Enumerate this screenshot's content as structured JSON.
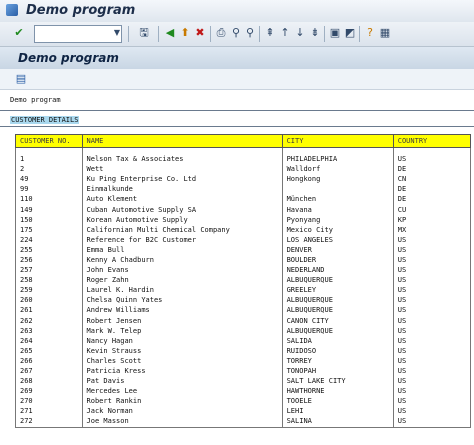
{
  "window": {
    "title": "Demo program"
  },
  "page": {
    "title": "Demo program",
    "heading": "Demo program",
    "section": "CUSTOMER DETAILS"
  },
  "table": {
    "columns": [
      "CUSTOMER NO.",
      "NAME",
      "CITY",
      "COUNTRY"
    ],
    "rows": [
      [
        "1",
        "Nelson Tax & Associates",
        "PHILADELPHIA",
        "US"
      ],
      [
        "2",
        "Wett",
        "Walldorf",
        "DE"
      ],
      [
        "49",
        "Ku Ping Enterprise Co. Ltd",
        "Hongkong",
        "CN"
      ],
      [
        "99",
        "Einmalkunde",
        "",
        "DE"
      ],
      [
        "110",
        "Auto Klement",
        "München",
        "DE"
      ],
      [
        "149",
        "Cuban Automotive Supply SA",
        "Havana",
        "CU"
      ],
      [
        "150",
        "Korean Automotive Supply",
        "Pyonyang",
        "KP"
      ],
      [
        "175",
        "Californian Multi Chemical Company",
        "Mexico City",
        "MX"
      ],
      [
        "224",
        "Reference for B2C Customer",
        "LOS ANGELES",
        "US"
      ],
      [
        "255",
        "Emma Bull",
        "DENVER",
        "US"
      ],
      [
        "256",
        "Kenny A Chadburn",
        "BOULDER",
        "US"
      ],
      [
        "257",
        "John Evans",
        "NEDERLAND",
        "US"
      ],
      [
        "258",
        "Roger Zahn",
        "ALBUQUERQUE",
        "US"
      ],
      [
        "259",
        "Laurel K. Hardin",
        "GREELEY",
        "US"
      ],
      [
        "260",
        "Chelsa Quinn Yates",
        "ALBUQUERQUE",
        "US"
      ],
      [
        "261",
        "Andrew Williams",
        "ALBUQUERQUE",
        "US"
      ],
      [
        "262",
        "Robert Jensen",
        "CANON CITY",
        "US"
      ],
      [
        "263",
        "Mark W. Telep",
        "ALBUQUERQUE",
        "US"
      ],
      [
        "264",
        "Nancy Hagan",
        "SALIDA",
        "US"
      ],
      [
        "265",
        "Kevin Strauss",
        "RUIDOSO",
        "US"
      ],
      [
        "266",
        "Charles Scott",
        "TORREY",
        "US"
      ],
      [
        "267",
        "Patricia Kress",
        "TONOPAH",
        "US"
      ],
      [
        "268",
        "Pat Davis",
        "SALT LAKE CITY",
        "US"
      ],
      [
        "269",
        "Mercedes Lee",
        "HAWTHORNE",
        "US"
      ],
      [
        "270",
        "Robert Rankin",
        "TOOELE",
        "US"
      ],
      [
        "271",
        "Jack Norman",
        "LEHI",
        "US"
      ],
      [
        "272",
        "Joe Masson",
        "SALINA",
        "US"
      ]
    ]
  },
  "colors": {
    "header_bg": "#ffff00",
    "section_bg": "#a9d8ee"
  }
}
